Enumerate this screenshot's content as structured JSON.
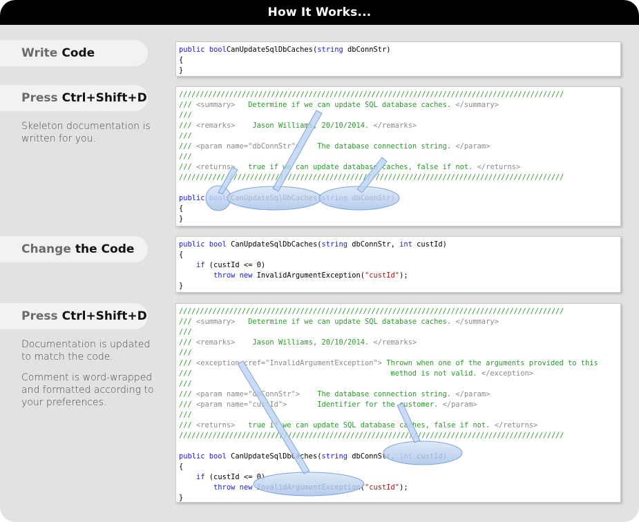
{
  "header": {
    "title": "How It Works..."
  },
  "steps": [
    {
      "verb": "Write",
      "object": "Code"
    },
    {
      "verb": "Press",
      "object": "Ctrl+Shift+D",
      "description": [
        "Skeleton documentation is written for you."
      ]
    },
    {
      "verb": "Change",
      "object": "the Code"
    },
    {
      "verb": "Press",
      "object": "Ctrl+Shift+D",
      "description": [
        "Documentation is updated to match the code.",
        "Comment is word-wrapped and formatted according to your preferences."
      ]
    }
  ],
  "code": {
    "box1": [
      [
        [
          "kw",
          "public bool"
        ],
        [
          "",
          "CanUpdateSqlDbCaches("
        ],
        [
          "kw",
          "string"
        ],
        [
          "",
          " dbConnStr)"
        ]
      ],
      [
        [
          "",
          "{"
        ]
      ],
      [
        [
          "",
          "}"
        ]
      ]
    ],
    "box2": [
      [
        [
          "slash",
          "////////////////////////////////////////////////////////////////////////////////////////////"
        ]
      ],
      [
        [
          "cm",
          "/// "
        ],
        [
          "tg",
          "<summary>"
        ],
        [
          "cm",
          "   Determine if we can update SQL database caches. "
        ],
        [
          "tg",
          "</summary>"
        ]
      ],
      [
        [
          "cm",
          "///"
        ]
      ],
      [
        [
          "cm",
          "/// "
        ],
        [
          "tg",
          "<remarks>"
        ],
        [
          "cm",
          "    Jason Williams, 20/10/2014. "
        ],
        [
          "tg",
          "</remarks>"
        ]
      ],
      [
        [
          "cm",
          "///"
        ]
      ],
      [
        [
          "cm",
          "/// "
        ],
        [
          "tg",
          "<param name=\"dbConnStr\">"
        ],
        [
          "cm",
          "    The database connection string. "
        ],
        [
          "tg",
          "</param>"
        ]
      ],
      [
        [
          "cm",
          "///"
        ]
      ],
      [
        [
          "cm",
          "/// "
        ],
        [
          "tg",
          "<returns>"
        ],
        [
          "cm",
          "   true if we can update database caches, false if not. "
        ],
        [
          "tg",
          "</returns>"
        ]
      ],
      [
        [
          "slash",
          "////////////////////////////////////////////////////////////////////////////////////////////"
        ]
      ],
      [
        [
          "",
          ""
        ]
      ],
      [
        [
          "kw",
          "public bool"
        ],
        [
          "",
          " CanUpdateSqlDbCaches("
        ],
        [
          "kw",
          "string"
        ],
        [
          "",
          " dbConnStr)"
        ]
      ],
      [
        [
          "",
          "{"
        ]
      ],
      [
        [
          "",
          "}"
        ]
      ]
    ],
    "box3": [
      [
        [
          "kw",
          "public bool"
        ],
        [
          "",
          " CanUpdateSqlDbCaches("
        ],
        [
          "kw",
          "string"
        ],
        [
          "",
          " dbConnStr, "
        ],
        [
          "kw",
          "int"
        ],
        [
          "",
          " custId)"
        ]
      ],
      [
        [
          "",
          "{"
        ]
      ],
      [
        [
          "",
          "    "
        ],
        [
          "kw",
          "if"
        ],
        [
          "",
          " (custId <= 0)"
        ]
      ],
      [
        [
          "",
          "        "
        ],
        [
          "kw",
          "throw new"
        ],
        [
          "",
          " InvalidArgumentException("
        ],
        [
          "st",
          "\"custId\""
        ],
        [
          "",
          ");"
        ]
      ],
      [
        [
          "",
          "}"
        ]
      ]
    ],
    "box4": [
      [
        [
          "slash",
          "////////////////////////////////////////////////////////////////////////////////////////////"
        ]
      ],
      [
        [
          "cm",
          "/// "
        ],
        [
          "tg",
          "<summary>"
        ],
        [
          "cm",
          "   Determine if we can update SQL database caches. "
        ],
        [
          "tg",
          "</summary>"
        ]
      ],
      [
        [
          "cm",
          "///"
        ]
      ],
      [
        [
          "cm",
          "/// "
        ],
        [
          "tg",
          "<remarks>"
        ],
        [
          "cm",
          "    Jason Williams, 20/10/2014. "
        ],
        [
          "tg",
          "</remarks>"
        ]
      ],
      [
        [
          "cm",
          "///"
        ]
      ],
      [
        [
          "cm",
          "/// "
        ],
        [
          "tg",
          "<exception cref=\"InvalidArgumentException\">"
        ],
        [
          "cm",
          " Thrown when one of the arguments provided to this"
        ]
      ],
      [
        [
          "cm",
          "///                                              method is not valid. "
        ],
        [
          "tg",
          "</exception>"
        ]
      ],
      [
        [
          "cm",
          "///"
        ]
      ],
      [
        [
          "cm",
          "/// "
        ],
        [
          "tg",
          "<param name=\"dbConnStr\">"
        ],
        [
          "cm",
          "    The database connection string. "
        ],
        [
          "tg",
          "</param>"
        ]
      ],
      [
        [
          "cm",
          "/// "
        ],
        [
          "tg",
          "<param name=\"custId\">"
        ],
        [
          "cm",
          "       Identifier for the customer. "
        ],
        [
          "tg",
          "</param>"
        ]
      ],
      [
        [
          "cm",
          "///"
        ]
      ],
      [
        [
          "cm",
          "/// "
        ],
        [
          "tg",
          "<returns>"
        ],
        [
          "cm",
          "   true if we can update SQL database caches, false if not. "
        ],
        [
          "tg",
          "</returns>"
        ]
      ],
      [
        [
          "slash",
          "////////////////////////////////////////////////////////////////////////////////////////////"
        ]
      ],
      [
        [
          "",
          ""
        ]
      ],
      [
        [
          "kw",
          "public bool"
        ],
        [
          "",
          " CanUpdateSqlDbCaches("
        ],
        [
          "kw",
          "string"
        ],
        [
          "",
          " dbConnStr, "
        ],
        [
          "kw",
          "int"
        ],
        [
          "",
          " custId)"
        ]
      ],
      [
        [
          "",
          "{"
        ]
      ],
      [
        [
          "",
          "    "
        ],
        [
          "kw",
          "if"
        ],
        [
          "",
          " (custId <= 0)"
        ]
      ],
      [
        [
          "",
          "        "
        ],
        [
          "kw",
          "throw new"
        ],
        [
          "",
          " InvalidArgumentException("
        ],
        [
          "st",
          "\"custId\""
        ],
        [
          "",
          ");"
        ]
      ],
      [
        [
          "",
          "}"
        ]
      ]
    ]
  },
  "colors": {
    "background": "#e2e2e2",
    "header": "#000000",
    "keyword": "#1a1ae6",
    "comment": "#2a9a2a",
    "xml_tag": "#8a8a8a",
    "string": "#a31515",
    "highlight": "#bcd3f2"
  }
}
